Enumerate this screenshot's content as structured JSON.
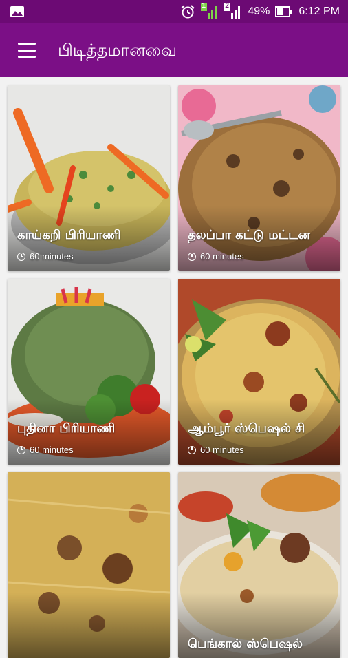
{
  "status_bar": {
    "battery_percent": "49%",
    "time": "6:12 PM",
    "sim1_label": "1",
    "sim2_label": "2",
    "icons": [
      "image-icon",
      "alarm-icon",
      "signal-sim1-icon",
      "signal-sim2-icon",
      "battery-icon"
    ]
  },
  "app_bar": {
    "title": "பிடித்தமானவை",
    "menu_icon": "hamburger-menu-icon"
  },
  "recipes": [
    {
      "title": "காய்கறி பிரியாணி",
      "time": "60 minutes",
      "icon": "clock-icon"
    },
    {
      "title": "தலப்பா கட்டு மட்டன",
      "time": "60 minutes",
      "icon": "clock-icon"
    },
    {
      "title": "புதினா பிரியாணி",
      "time": "60 minutes",
      "icon": "clock-icon"
    },
    {
      "title": "ஆம்பூர் ஸ்பெஷல் சி",
      "time": "60 minutes",
      "icon": "clock-icon"
    },
    {
      "title": "",
      "time": "",
      "icon": ""
    },
    {
      "title": "பெங்கால் ஸ்பெஷல்",
      "time": "",
      "icon": ""
    }
  ],
  "colors": {
    "status_bar": "#6c0a74",
    "app_bar": "#7b0f86",
    "text_on_primary": "#ffffff"
  }
}
